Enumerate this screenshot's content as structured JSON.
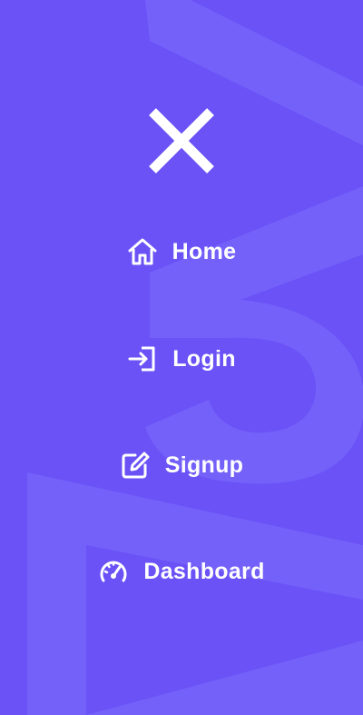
{
  "colors": {
    "background": "#6a52f7",
    "background_art": "#7661fa",
    "foreground": "#ffffff"
  },
  "close_button": {
    "icon": "close-icon"
  },
  "nav": {
    "items": [
      {
        "label": "Home",
        "icon": "home-icon"
      },
      {
        "label": "Login",
        "icon": "login-icon"
      },
      {
        "label": "Signup",
        "icon": "edit-icon"
      },
      {
        "label": "Dashboard",
        "icon": "speedometer-icon"
      }
    ]
  }
}
